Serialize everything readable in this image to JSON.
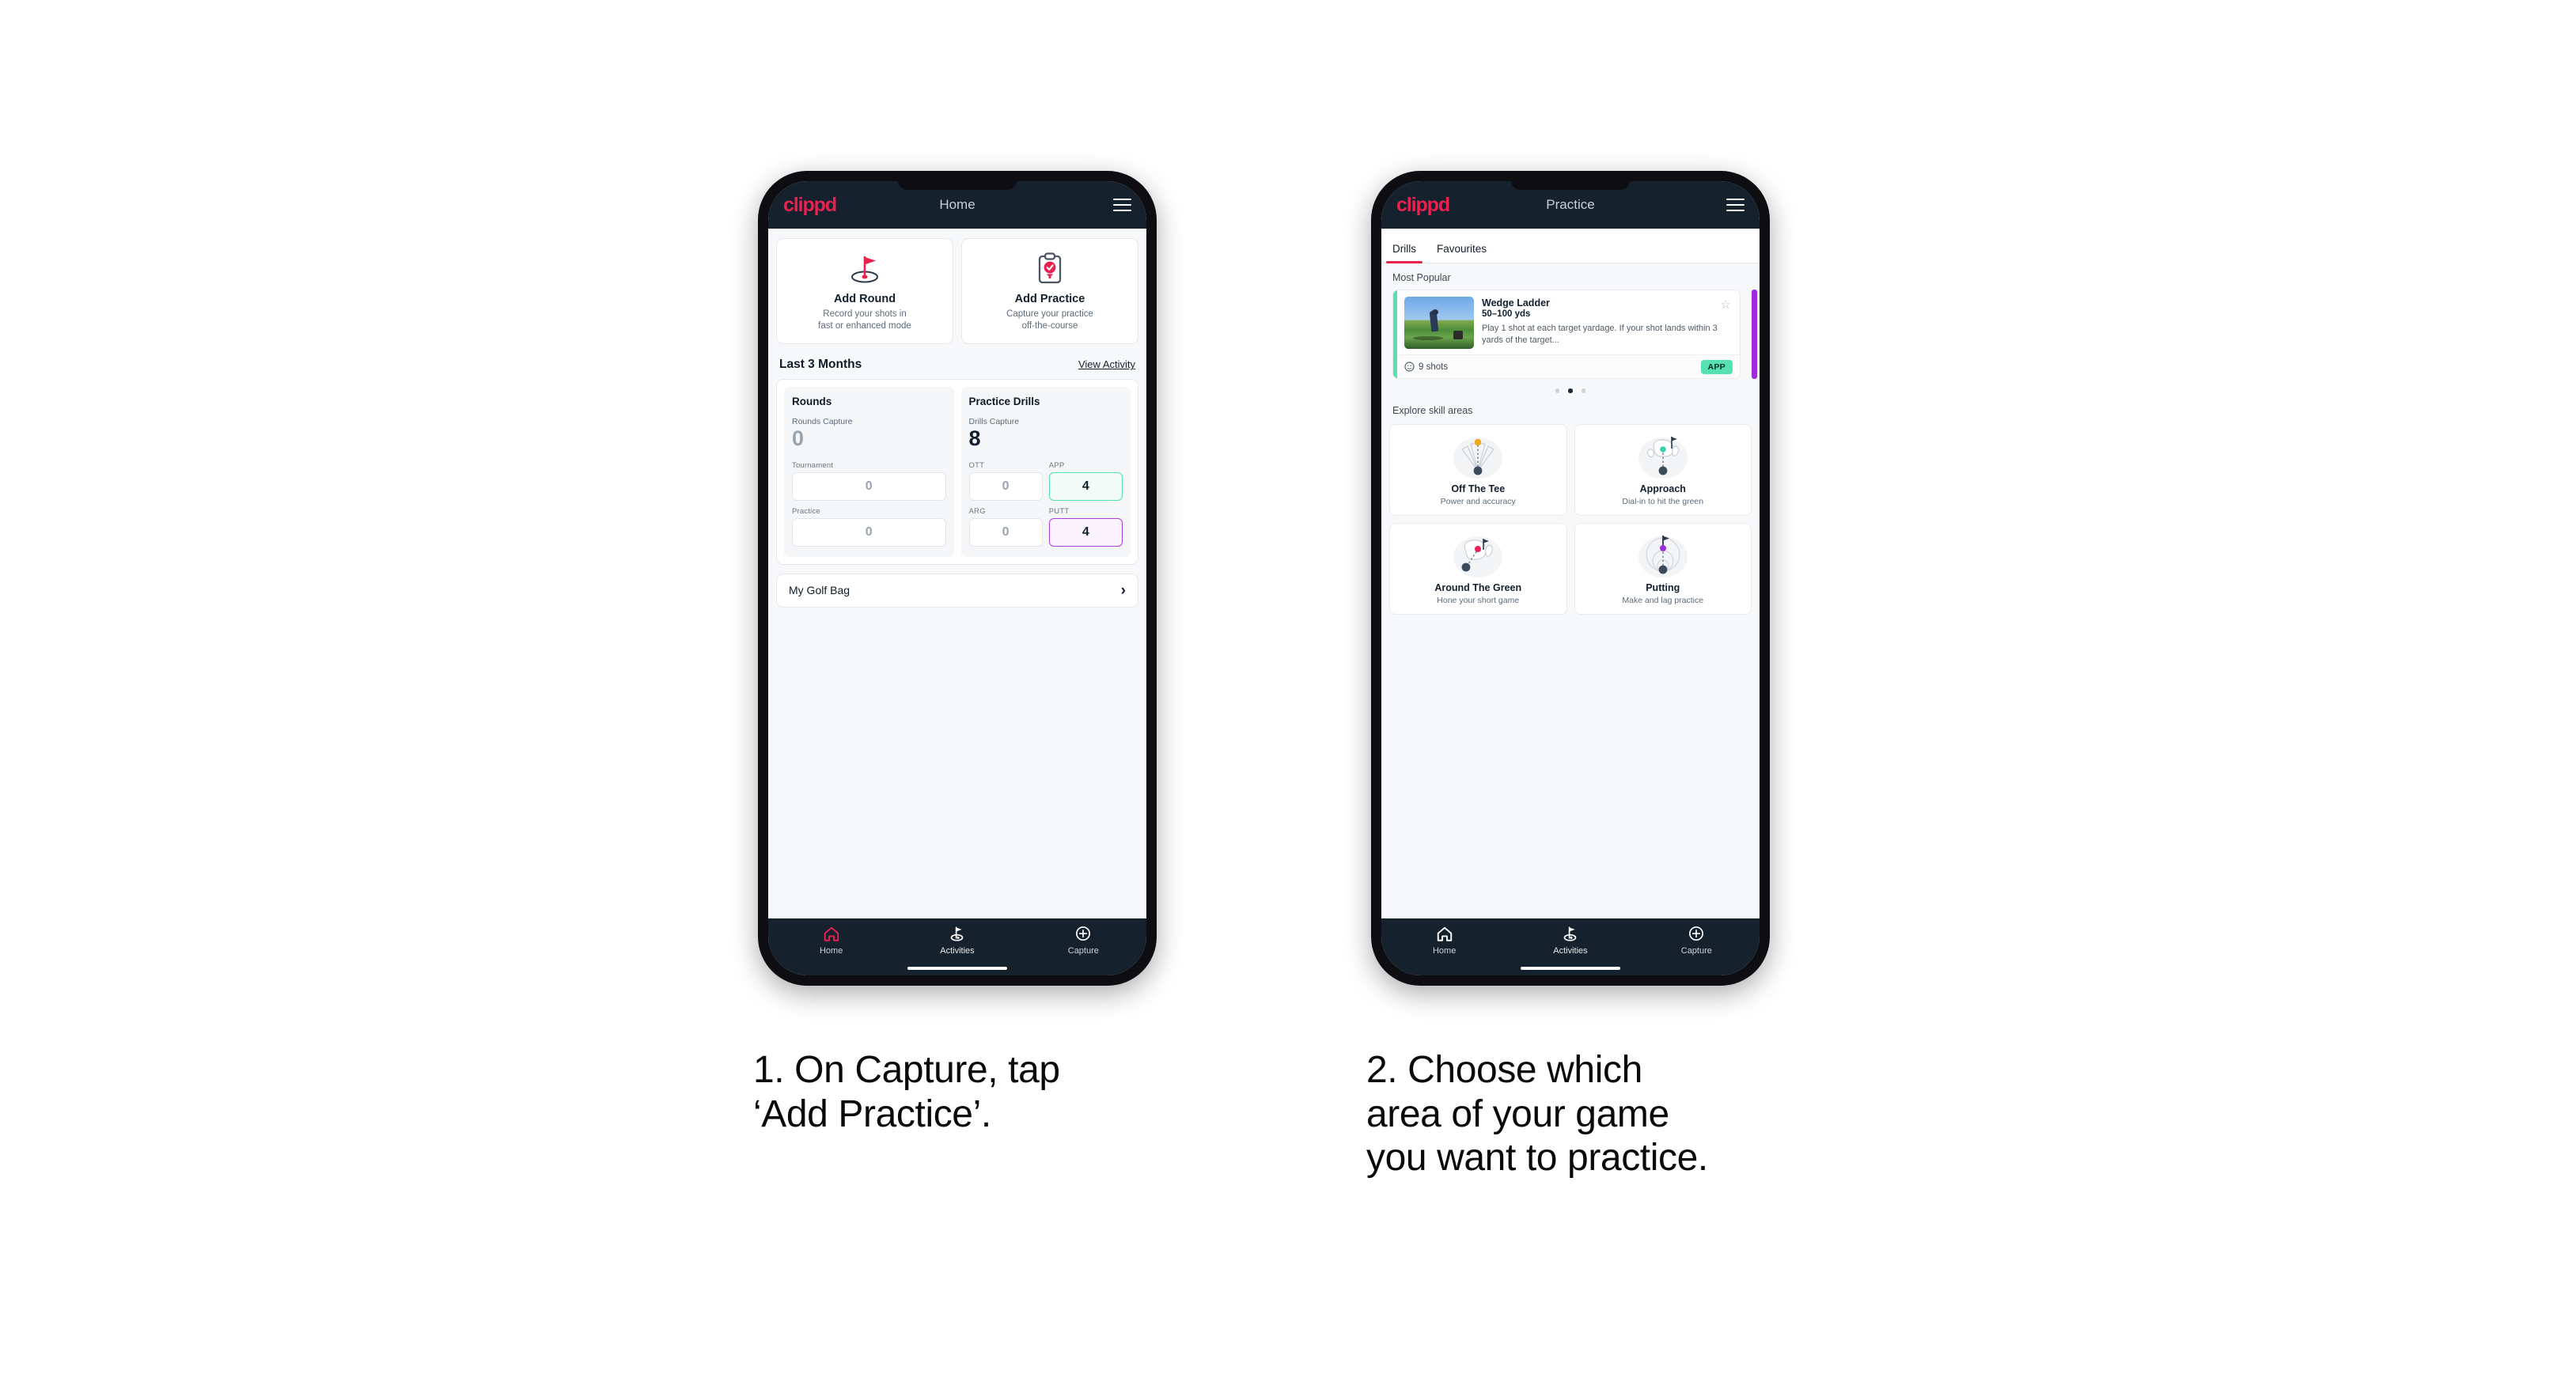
{
  "brand": {
    "logo": "clippd",
    "accent": "#e8214f",
    "dark": "#16212e"
  },
  "phone1": {
    "appbar": {
      "title": "Home",
      "menu_icon": "hamburger-icon"
    },
    "actions": [
      {
        "icon": "golf-flag-hole-icon",
        "title": "Add Round",
        "sub_line1": "Record your shots in",
        "sub_line2": "fast or enhanced mode"
      },
      {
        "icon": "clipboard-check-tee-icon",
        "title": "Add Practice",
        "sub_line1": "Capture your practice",
        "sub_line2": "off-the-course"
      }
    ],
    "section": {
      "title": "Last 3 Months",
      "link": "View Activity"
    },
    "stats": {
      "rounds": {
        "heading": "Rounds",
        "capture_label": "Rounds Capture",
        "capture_value": "0",
        "items": [
          {
            "label": "Tournament",
            "value": "0",
            "style": "plain"
          },
          {
            "label": "Practice",
            "value": "0",
            "style": "plain"
          }
        ]
      },
      "drills": {
        "heading": "Practice Drills",
        "capture_label": "Drills Capture",
        "capture_value": "8",
        "items": [
          {
            "label": "OTT",
            "value": "0",
            "style": "plain"
          },
          {
            "label": "APP",
            "value": "4",
            "style": "app"
          },
          {
            "label": "ARG",
            "value": "0",
            "style": "plain"
          },
          {
            "label": "PUTT",
            "value": "4",
            "style": "putt"
          }
        ]
      }
    },
    "golf_bag": {
      "label": "My Golf Bag",
      "chevron": "chevron-right-icon"
    },
    "nav": [
      {
        "icon": "home-icon",
        "label": "Home",
        "active": true
      },
      {
        "icon": "golf-flag-icon",
        "label": "Activities",
        "active": false
      },
      {
        "icon": "plus-circle-icon",
        "label": "Capture",
        "active": false
      }
    ]
  },
  "phone2": {
    "appbar": {
      "title": "Practice",
      "menu_icon": "hamburger-icon"
    },
    "tabs": [
      {
        "label": "Drills",
        "active": true
      },
      {
        "label": "Favourites",
        "active": false
      }
    ],
    "most_popular_label": "Most Popular",
    "drill": {
      "title": "Wedge Ladder",
      "yards": "50–100 yds",
      "description": "Play 1 shot at each target yardage. If your shot lands within 3 yards of the target...",
      "shots": "9 shots",
      "badge": "APP",
      "badge_color": "#57e0b0",
      "accent_color": "#57e0b0",
      "star_icon": "star-outline-icon",
      "clock_icon": "clock-icon",
      "thumbnail": "golfer-chipping-photo"
    },
    "carousel_dots": {
      "count": 3,
      "active_index": 1
    },
    "explore_label": "Explore skill areas",
    "skills": [
      {
        "icon": "tee-shot-fan-icon",
        "title": "Off The Tee",
        "sub": "Power and accuracy",
        "dot_color": "#f0a81e"
      },
      {
        "icon": "green-approach-icon",
        "title": "Approach",
        "sub": "Dial-in to hit the green",
        "dot_color": "#3ecfb0"
      },
      {
        "icon": "around-green-icon",
        "title": "Around The Green",
        "sub": "Hone your short game",
        "dot_color": "#e8215c"
      },
      {
        "icon": "putting-rings-icon",
        "title": "Putting",
        "sub": "Make and lag practice",
        "dot_color": "#a02ddb"
      }
    ],
    "nav": [
      {
        "icon": "home-icon",
        "label": "Home",
        "active": false
      },
      {
        "icon": "golf-flag-icon",
        "label": "Activities",
        "active": false
      },
      {
        "icon": "plus-circle-icon",
        "label": "Capture",
        "active": false
      }
    ]
  },
  "captions": {
    "one": {
      "line1": "1. On Capture, tap",
      "line2": "‘Add Practice’."
    },
    "two": {
      "line1": "2. Choose which",
      "line2": "area of your game",
      "line3": "you want to practice."
    }
  }
}
